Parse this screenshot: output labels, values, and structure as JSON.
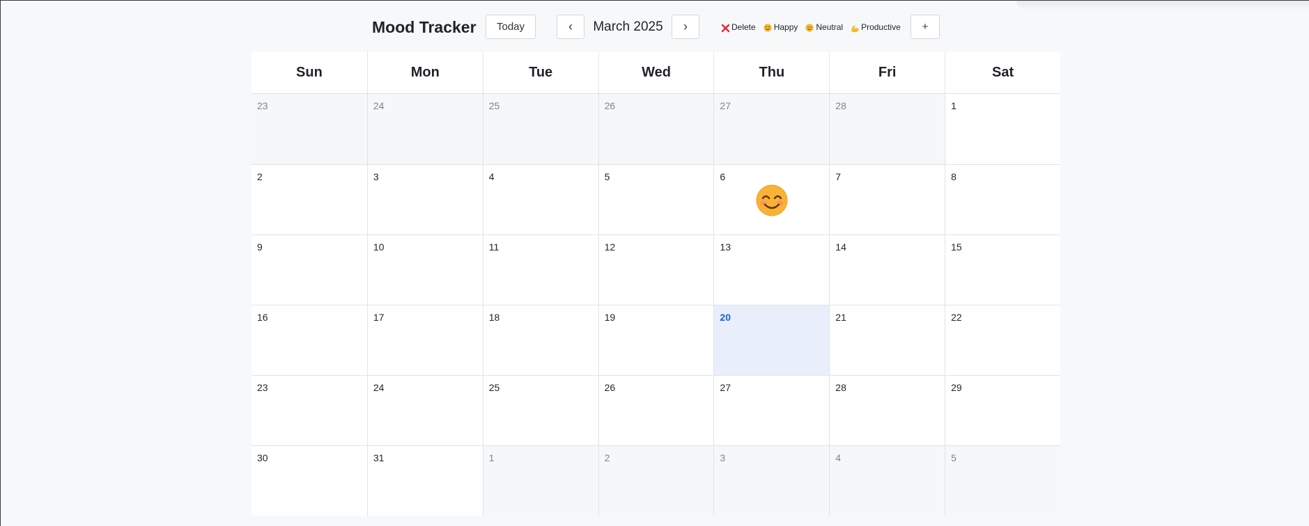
{
  "app": {
    "title": "Mood Tracker"
  },
  "toolbar": {
    "today_label": "Today",
    "prev_label": "‹",
    "next_label": "›",
    "month_label": "March 2025",
    "add_label": "+"
  },
  "legend": [
    {
      "label": "Delete",
      "icon": "close-icon",
      "color": "#e5243b"
    },
    {
      "label": "Happy",
      "icon": "smiling-face-icon",
      "color": "#f5a623"
    },
    {
      "label": "Neutral",
      "icon": "neutral-face-icon",
      "color": "#f5a623"
    },
    {
      "label": "Productive",
      "icon": "flexed-biceps-icon",
      "color": "#f5a623"
    }
  ],
  "calendar": {
    "weekdays": [
      "Sun",
      "Mon",
      "Tue",
      "Wed",
      "Thu",
      "Fri",
      "Sat"
    ],
    "days": [
      {
        "d": "23",
        "other": true
      },
      {
        "d": "24",
        "other": true
      },
      {
        "d": "25",
        "other": true
      },
      {
        "d": "26",
        "other": true
      },
      {
        "d": "27",
        "other": true
      },
      {
        "d": "28",
        "other": true
      },
      {
        "d": "1"
      },
      {
        "d": "2"
      },
      {
        "d": "3"
      },
      {
        "d": "4"
      },
      {
        "d": "5"
      },
      {
        "d": "6",
        "mood": "happy"
      },
      {
        "d": "7"
      },
      {
        "d": "8"
      },
      {
        "d": "9"
      },
      {
        "d": "10"
      },
      {
        "d": "11"
      },
      {
        "d": "12"
      },
      {
        "d": "13"
      },
      {
        "d": "14"
      },
      {
        "d": "15"
      },
      {
        "d": "16"
      },
      {
        "d": "17"
      },
      {
        "d": "18"
      },
      {
        "d": "19"
      },
      {
        "d": "20",
        "today": true
      },
      {
        "d": "21"
      },
      {
        "d": "22"
      },
      {
        "d": "23"
      },
      {
        "d": "24"
      },
      {
        "d": "25"
      },
      {
        "d": "26"
      },
      {
        "d": "27"
      },
      {
        "d": "28"
      },
      {
        "d": "29"
      },
      {
        "d": "30"
      },
      {
        "d": "31"
      },
      {
        "d": "1",
        "other": true
      },
      {
        "d": "2",
        "other": true
      },
      {
        "d": "3",
        "other": true
      },
      {
        "d": "4",
        "other": true
      },
      {
        "d": "5",
        "other": true
      }
    ]
  },
  "colors": {
    "today_bg": "#e8effb",
    "today_text": "#1a5fd6",
    "other_month_bg": "#f6f7f9",
    "delete_red": "#e5243b"
  }
}
